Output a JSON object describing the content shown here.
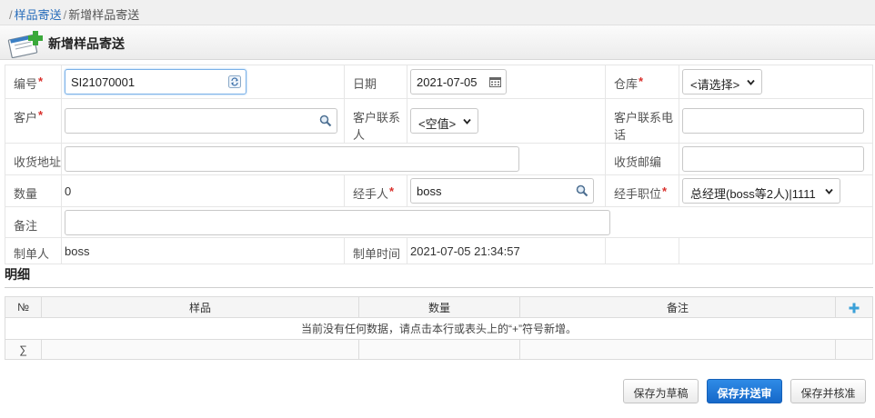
{
  "breadcrumb": {
    "root": "样品寄送",
    "current": "新增样品寄送"
  },
  "page": {
    "title": "新增样品寄送"
  },
  "form": {
    "number": {
      "label": "编号",
      "value": "SI21070001"
    },
    "date": {
      "label": "日期",
      "value": "2021-07-05"
    },
    "warehouse": {
      "label": "仓库",
      "value": "<请选择>"
    },
    "customer": {
      "label": "客户",
      "value": ""
    },
    "contact": {
      "label": "客户联系人",
      "value": "<空值>"
    },
    "contact_phone": {
      "label": "客户联系电话",
      "value": ""
    },
    "address": {
      "label": "收货地址",
      "value": ""
    },
    "zipcode": {
      "label": "收货邮编",
      "value": ""
    },
    "quantity": {
      "label": "数量",
      "value": "0"
    },
    "handler": {
      "label": "经手人",
      "value": "boss"
    },
    "position": {
      "label": "经手职位",
      "value": "总经理(boss等2人)|1111"
    },
    "remark": {
      "label": "备注",
      "value": ""
    },
    "creator": {
      "label": "制单人",
      "value": "boss"
    },
    "created_time": {
      "label": "制单时间",
      "value": "2021-07-05 21:34:57"
    },
    "required_mark": "*"
  },
  "detail": {
    "title": "明细",
    "columns": {
      "no": "№",
      "sample": "样品",
      "qty": "数量",
      "remark": "备注"
    },
    "empty_message": "当前没有任何数据，请点击本行或表头上的“+”符号新增。",
    "sum_symbol": "∑"
  },
  "buttons": {
    "save_draft": "保存为草稿",
    "save_submit": "保存并送审",
    "save_approve": "保存并核准"
  },
  "colors": {
    "link": "#2a6ebb",
    "required": "#d9302c",
    "primary": "#1668c9",
    "add": "#3aa0d8"
  }
}
